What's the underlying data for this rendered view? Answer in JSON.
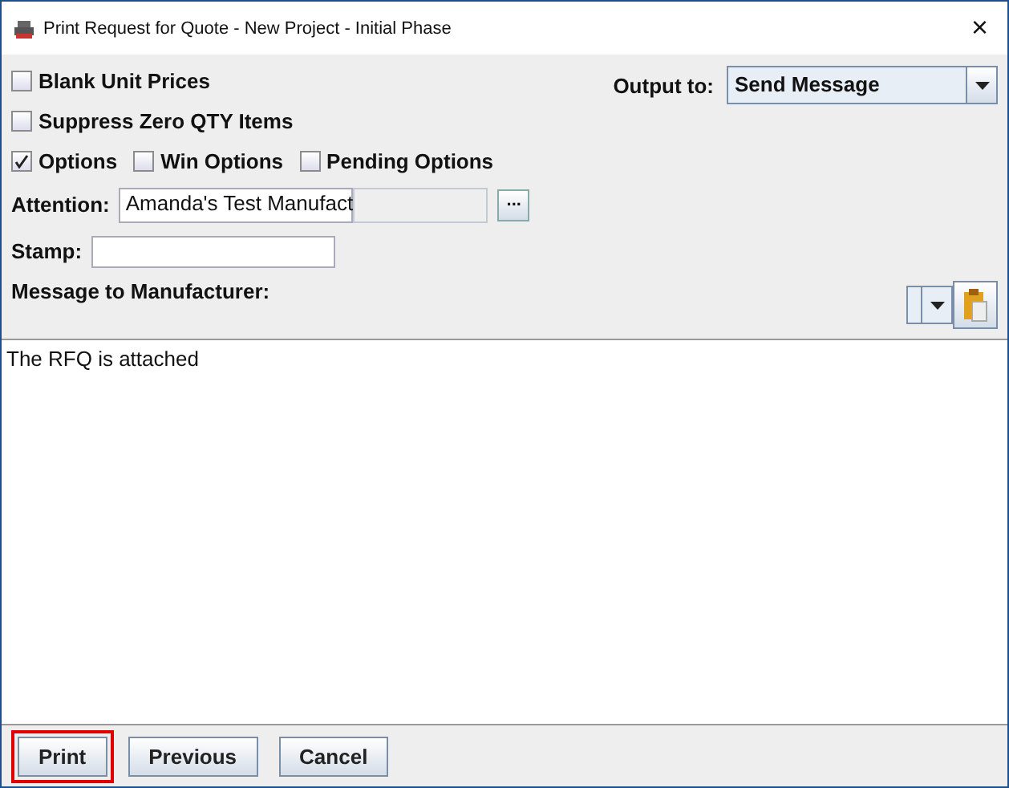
{
  "window": {
    "title": "Print Request for Quote - New Project - Initial Phase",
    "close": "×"
  },
  "checkboxes_top": [
    {
      "label": "Blank Unit Prices",
      "checked": false
    },
    {
      "label": "Suppress Zero QTY Items",
      "checked": false
    }
  ],
  "options": [
    {
      "label": "Options",
      "checked": true
    },
    {
      "label": "Win Options",
      "checked": false
    },
    {
      "label": "Pending Options",
      "checked": false
    }
  ],
  "output": {
    "label": "Output to:",
    "value": "Send Message"
  },
  "attention": {
    "label": "Attention:",
    "value": "Amanda's Test Manufact",
    "browse": "..."
  },
  "stamp": {
    "label": "Stamp:"
  },
  "message": {
    "label": "Message to Manufacturer:",
    "text": "The RFQ is attached"
  },
  "buttons": [
    {
      "label": "Print",
      "highlighted": true
    },
    {
      "label": "Previous",
      "highlighted": false
    },
    {
      "label": "Cancel",
      "highlighted": false
    }
  ]
}
